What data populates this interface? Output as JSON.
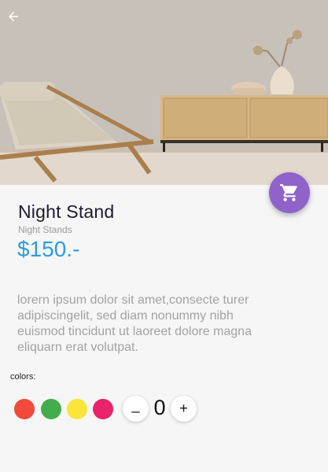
{
  "header": {
    "back_icon": "arrow-left-icon"
  },
  "hero": {
    "image_icon": "product-photo"
  },
  "cart_button": {
    "icon": "shopping-cart-icon",
    "color": "#8f63c9"
  },
  "product": {
    "title": "Night Stand",
    "category": "Night Stands",
    "price": "$150.-",
    "price_color": "#2f9be0",
    "description": "lorern ipsum dolor sit amet,consecte turer adipiscingelit, sed diam nonummy nibh euismod tincidunt ut laoreet dolore magna eliquarn erat volutpat."
  },
  "colors": {
    "label": "colors:",
    "swatches": [
      "#f14a3b",
      "#43ac4c",
      "#fbe53a",
      "#e8246a"
    ]
  },
  "quantity": {
    "minus_label": "_",
    "value": "0",
    "plus_label": "+"
  }
}
